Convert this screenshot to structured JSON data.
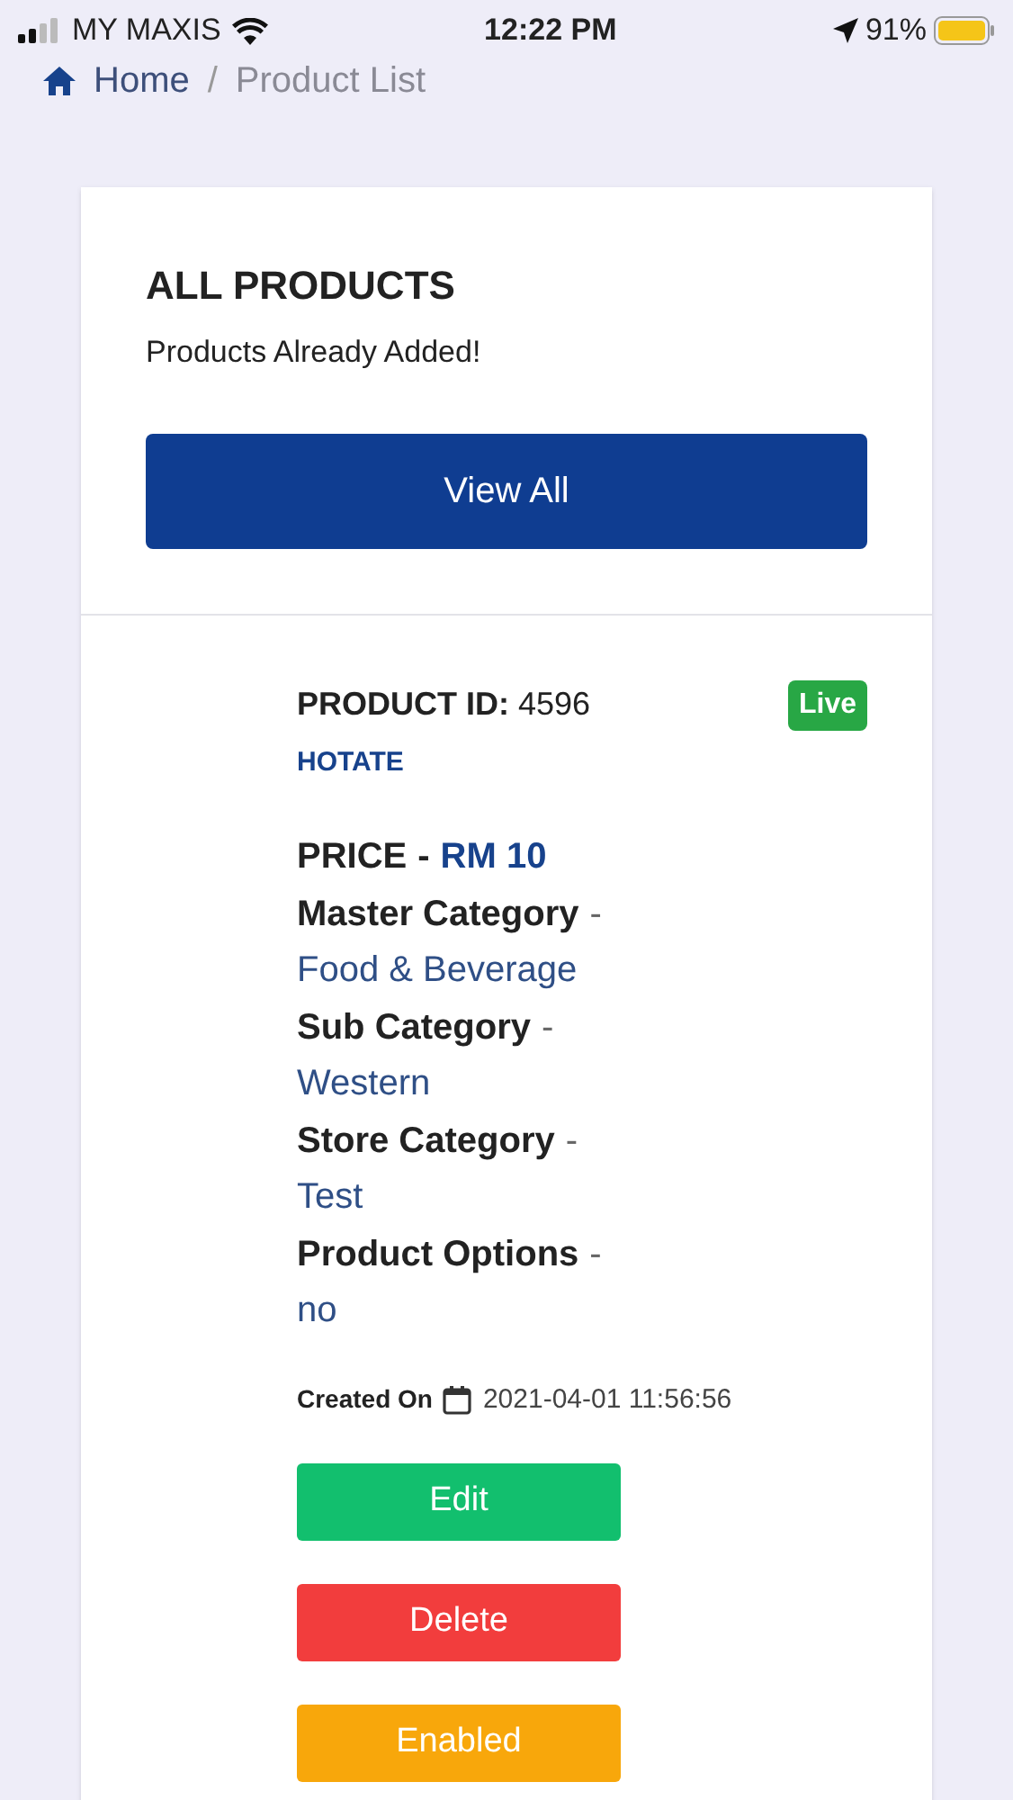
{
  "status_bar": {
    "carrier": "MY MAXIS",
    "time": "12:22 PM",
    "battery": "91%"
  },
  "breadcrumb": [
    {
      "label": "Home",
      "selected": false
    },
    {
      "label": "Product List",
      "selected": true
    }
  ],
  "separator": "/",
  "header": {
    "title": "ALL PRODUCTS",
    "subtitle": "Products Already Added!",
    "button": "View All"
  },
  "product": {
    "id_label": "PRODUCT ID:",
    "id": "4596",
    "name": "HOTATE",
    "status": "Live",
    "details": [
      {
        "kind": "price",
        "label": "PRICE",
        "sep": "-",
        "value": "RM 10"
      },
      {
        "kind": "plain",
        "label": "Master Category",
        "sep": "-",
        "value": "Food & Beverage"
      },
      {
        "kind": "plain",
        "label": "Sub Category",
        "sep": "-",
        "value": "Western"
      },
      {
        "kind": "plain",
        "label": "Store Category",
        "sep": "-",
        "value": "Test"
      },
      {
        "kind": "plain",
        "label": "Product Options",
        "sep": "-",
        "value": "no"
      }
    ],
    "created_label": "Created On",
    "created": "2021-04-01 11:56:56",
    "actions": [
      {
        "kind": "edit",
        "label": "Edit"
      },
      {
        "kind": "delete",
        "label": "Delete"
      },
      {
        "kind": "toggle",
        "label": "Enabled"
      }
    ]
  }
}
